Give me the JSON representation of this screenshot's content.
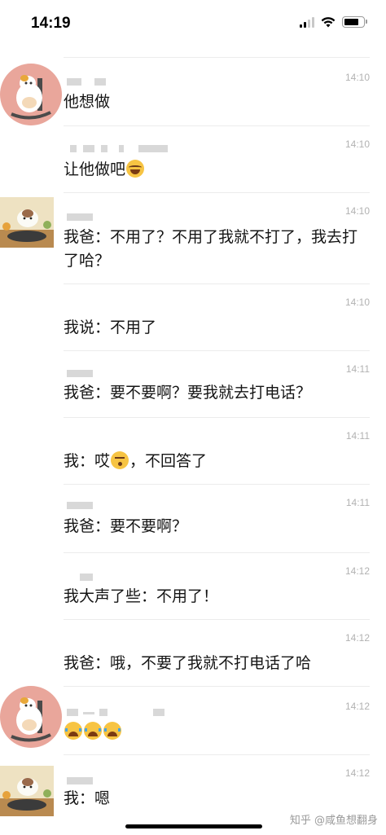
{
  "status_bar": {
    "time": "14:19",
    "battery_level": 0.8,
    "signal_bars": 2
  },
  "messages": [
    {
      "time": "14:10",
      "text": "他想做",
      "emoji": []
    },
    {
      "time": "14:10",
      "text": "让他做吧",
      "emoji": [
        "laugh"
      ]
    },
    {
      "time": "14:10",
      "text": "我爸：不用了？不用了我就不打了，我去打了哈？",
      "emoji": []
    },
    {
      "time": "14:10",
      "text": "我说：不用了",
      "emoji": []
    },
    {
      "time": "14:11",
      "text": "我爸：要不要啊？要我就去打电话？",
      "emoji": []
    },
    {
      "time": "14:11",
      "text": "我：哎",
      "text_after": "，不回答了",
      "emoji": [
        "hum"
      ]
    },
    {
      "time": "14:11",
      "text": "我爸：要不要啊？",
      "emoji": []
    },
    {
      "time": "14:12",
      "text": "我大声了些：不用了！",
      "emoji": []
    },
    {
      "time": "14:12",
      "text": "我爸：哦，不要了我就不打电话了哈",
      "emoji": []
    },
    {
      "time": "14:12",
      "text": "",
      "emoji": [
        "cry",
        "cry",
        "cry"
      ]
    },
    {
      "time": "14:12",
      "text": "我：嗯",
      "emoji": []
    }
  ],
  "watermark": "知乎 @咸鱼想翻身"
}
